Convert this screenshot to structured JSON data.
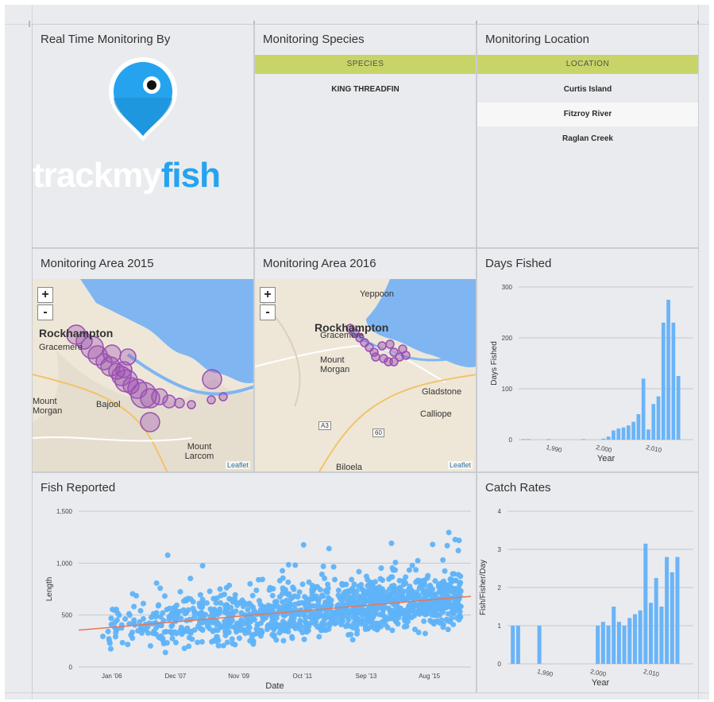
{
  "panels": {
    "realtime": {
      "title": "Real Time Monitoring By",
      "logo": {
        "part1": "trackmy",
        "part2": "fish",
        "pin_icon": "map-pin-icon",
        "pin_color": "#25a3ee"
      }
    },
    "species": {
      "title": "Monitoring Species",
      "header": "SPECIES",
      "rows": [
        "KING THREADFIN"
      ]
    },
    "location": {
      "title": "Monitoring Location",
      "header": "LOCATION",
      "rows": [
        "Curtis Island",
        "Fitzroy River",
        "Raglan Creek"
      ]
    },
    "map2015": {
      "title": "Monitoring Area 2015",
      "zoom_in": "+",
      "zoom_out": "-",
      "places": [
        "Rockhampton",
        "Gracemere",
        "Mount Morgan",
        "Bajool",
        "Mount Larcom"
      ],
      "attribution": "Leaflet"
    },
    "map2016": {
      "title": "Monitoring Area 2016",
      "zoom_in": "+",
      "zoom_out": "-",
      "places": [
        "Yeppoon",
        "Rockhampton",
        "Gracemere",
        "Mount Morgan",
        "Gladstone",
        "Calliope",
        "A3",
        "60",
        "Biloela"
      ],
      "attribution": "Leaflet"
    },
    "days_fished": {
      "title": "Days Fished"
    },
    "fish_reported": {
      "title": "Fish Reported"
    },
    "catch_rates": {
      "title": "Catch Rates"
    }
  },
  "colors": {
    "background": "#e9ebee",
    "table_header": "#c8d468",
    "bar": "#6ab4f8",
    "scatter": "#5fb3f8",
    "trend": "#e87656",
    "marker": "#9a4fb3",
    "map_water": "#7fb6f2",
    "map_land": "#eee7d8"
  },
  "chart_data": [
    {
      "id": "days_fished",
      "type": "bar",
      "xlabel": "Year",
      "ylabel": "Days Fished",
      "xlim": [
        1983,
        2018
      ],
      "ylim": [
        0,
        300
      ],
      "yticks": [
        0,
        100,
        200,
        300
      ],
      "xticks": [
        1990,
        2000,
        2010
      ],
      "x_tick_labels": [
        "1,990",
        "2,000",
        "2,010"
      ],
      "x": [
        1984,
        1985,
        1989,
        1996,
        2000,
        2001,
        2002,
        2003,
        2004,
        2005,
        2006,
        2007,
        2008,
        2009,
        2010,
        2011,
        2012,
        2013,
        2014,
        2015,
        2016,
        2017
      ],
      "values": [
        1,
        1,
        1,
        1,
        2,
        6,
        18,
        22,
        24,
        28,
        35,
        50,
        120,
        20,
        70,
        85,
        230,
        275,
        230,
        125,
        0,
        0
      ]
    },
    {
      "id": "fish_reported",
      "type": "scatter",
      "xlabel": "Date",
      "ylabel": "Length",
      "xlim": [
        "2005-01",
        "2016-11"
      ],
      "ylim": [
        0,
        1500
      ],
      "yticks": [
        0,
        500,
        1000,
        1500
      ],
      "y_tick_labels": [
        "0",
        "500",
        "1,000",
        "1,500"
      ],
      "x_tick_labels": [
        "Jan '06",
        "Dec '07",
        "Nov '09",
        "Oct '11",
        "Sep '13",
        "Aug '15"
      ],
      "trend_line": {
        "x": [
          "2005-01",
          "2016-11"
        ],
        "y": [
          355,
          680
        ]
      }
    },
    {
      "id": "catch_rates",
      "type": "bar",
      "xlabel": "Year",
      "ylabel": "Fish/Fisher/Day",
      "xlim": [
        1983,
        2018
      ],
      "ylim": [
        0,
        4
      ],
      "yticks": [
        0,
        1,
        2,
        3,
        4
      ],
      "xticks": [
        1990,
        2000,
        2010
      ],
      "x_tick_labels": [
        "1,990",
        "2,000",
        "2,010"
      ],
      "x": [
        1984,
        1985,
        1989,
        2000,
        2001,
        2002,
        2003,
        2004,
        2005,
        2006,
        2007,
        2008,
        2009,
        2010,
        2011,
        2012,
        2013,
        2014,
        2015
      ],
      "values": [
        1,
        1,
        1,
        1,
        1.1,
        1,
        1.5,
        1.1,
        1,
        1.2,
        1.3,
        1.4,
        3.15,
        1.6,
        2.25,
        1.5,
        2.8,
        2.4,
        2.8
      ]
    }
  ]
}
